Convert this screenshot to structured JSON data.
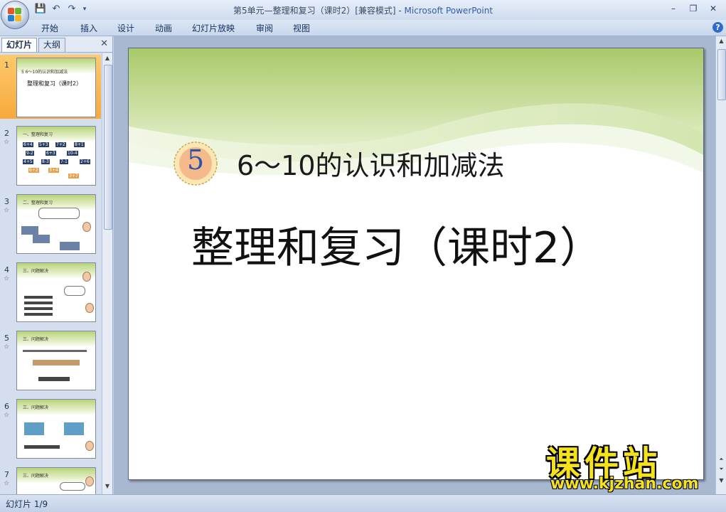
{
  "window": {
    "title_doc": "第5单元—整理和复习（课时2）[兼容模式]",
    "title_sep": " - ",
    "title_app": "Microsoft PowerPoint"
  },
  "ribbon": {
    "tabs": [
      "开始",
      "插入",
      "设计",
      "动画",
      "幻灯片放映",
      "审阅",
      "视图"
    ],
    "help": "?"
  },
  "pane": {
    "tab_slides": "幻灯片",
    "tab_outline": "大纲",
    "close": "✕",
    "thumbs": [
      {
        "num": "1",
        "line1": "5  6～10的认识和加减法",
        "line2": "整理和复习（课时2）"
      },
      {
        "num": "2",
        "line1": "一、整理和复习"
      },
      {
        "num": "3",
        "line1": "二、整理和复习"
      },
      {
        "num": "4",
        "line1": "三、问题解决"
      },
      {
        "num": "5",
        "line1": "三、问题解决"
      },
      {
        "num": "6",
        "line1": "三、问题解决"
      },
      {
        "num": "7",
        "line1": "三、问题解决"
      }
    ],
    "star": "☆"
  },
  "slide": {
    "unit_number": "5",
    "unit_title": "6～10的认识和加减法",
    "lesson_title": "整理和复习（课时2）"
  },
  "status": {
    "slide_indicator": "幻灯片 1/9"
  },
  "watermark": {
    "brand": "课件站",
    "url": "www.kjzhan.com"
  },
  "colors": {
    "selected_thumb": "#f7a93c",
    "wave_green": "#b8d27a",
    "badge_orange": "#f6b98c",
    "badge_number": "#2a56a8",
    "watermark_yellow": "#f5e21a"
  }
}
